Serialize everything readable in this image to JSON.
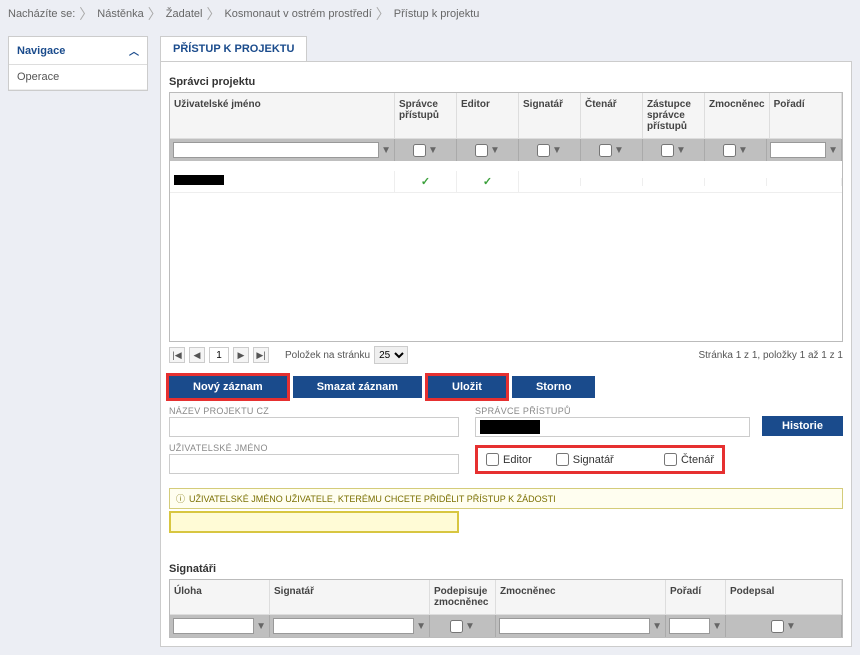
{
  "breadcrumb": {
    "label": "Nacházíte se:",
    "items": [
      "Nástěnka",
      "Žadatel",
      "Kosmonaut v ostrém prostředí",
      "Přístup k projektu"
    ]
  },
  "sidebar": {
    "nav_title": "Navigace",
    "items": [
      {
        "label": "Operace"
      }
    ]
  },
  "page": {
    "title": "PŘÍSTUP K PROJEKTU"
  },
  "section_admins": {
    "title": "Správci projektu",
    "columns": {
      "username": "Uživatelské jméno",
      "spravce": "Správce přístupů",
      "editor": "Editor",
      "signatar": "Signatář",
      "ctenar": "Čtenář",
      "zastupce": "Zástupce správce přístupů",
      "zmocnenec": "Zmocněnec",
      "poradi": "Pořadí"
    },
    "rows": [
      {
        "username_redacted": true,
        "spravce": true,
        "editor": true,
        "signatar": false,
        "ctenar": false,
        "zastupce": false,
        "zmocnenec": false,
        "poradi": ""
      }
    ]
  },
  "pager": {
    "page": "1",
    "per_page_label": "Položek na stránku",
    "per_page": "25",
    "summary": "Stránka 1 z 1, položky 1 až 1 z 1"
  },
  "actions": {
    "novy": "Nový záznam",
    "smazat": "Smazat záznam",
    "ulozit": "Uložit",
    "storno": "Storno",
    "historie": "Historie"
  },
  "form": {
    "nazev_projektu_label": "NÁZEV PROJEKTU CZ",
    "nazev_projektu": "",
    "uzivatelske_jmeno_label": "UŽIVATELSKÉ JMÉNO",
    "uzivatelske_jmeno": "",
    "spravce_pristupu_label": "SPRÁVCE PŘÍSTUPŮ",
    "checkboxes": {
      "editor": "Editor",
      "signatar": "Signatář",
      "ctenar": "Čtenář"
    },
    "info": "UŽIVATELSKÉ JMÉNO UŽIVATELE, KTERÉMU CHCETE PŘIDĚLIT PŘÍSTUP K ŽÁDOSTI"
  },
  "section_signatari": {
    "title": "Signatáři",
    "columns": {
      "uloha": "Úloha",
      "signatar": "Signatář",
      "podepisuje": "Podepisuje zmocněnec",
      "zmocnenec": "Zmocněnec",
      "poradi": "Pořadí",
      "podepsal": "Podepsal"
    }
  }
}
